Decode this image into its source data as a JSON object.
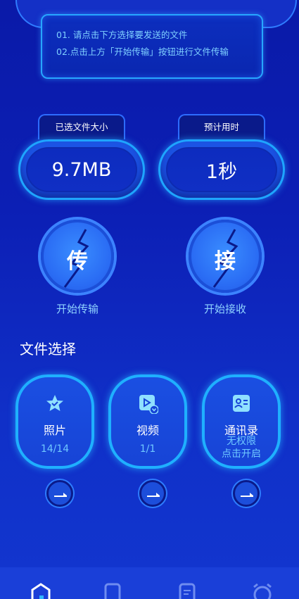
{
  "tips": {
    "line1": "01. 请点击下方选择要发送的文件",
    "line2": "02.点击上方「开始传输」按钮进行文件传输"
  },
  "stats": {
    "selected_size_label": "已选文件大小",
    "selected_size_value": "9.7MB",
    "estimated_time_label": "预计用时",
    "estimated_time_value": "1秒"
  },
  "actions": {
    "send_glyph": "传",
    "send_label": "开始传输",
    "receive_glyph": "接",
    "receive_label": "开始接收"
  },
  "section": {
    "title": "文件选择"
  },
  "files": [
    {
      "name": "照片",
      "count": "14/14",
      "icon": "star-icon"
    },
    {
      "name": "视频",
      "count": "1/1",
      "icon": "video-icon"
    },
    {
      "name": "通讯录",
      "permission_line1": "无权限",
      "permission_line2": "点击开启",
      "icon": "contacts-icon"
    }
  ],
  "bottom_tabs": [
    {
      "icon": "home-icon"
    },
    {
      "icon": "phone-icon"
    },
    {
      "icon": "document-icon"
    },
    {
      "icon": "clock-icon"
    }
  ],
  "colors": {
    "accent": "#1ea5ff",
    "label": "#8fd3ff",
    "tip_text": "#7fd0ff"
  }
}
